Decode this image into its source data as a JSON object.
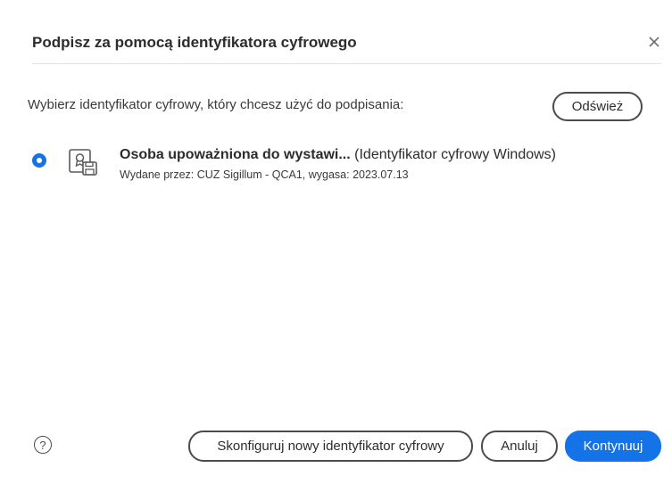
{
  "dialog": {
    "title": "Podpisz za pomocą identyfikatora cyfrowego",
    "close_icon": "close-icon",
    "prompt": "Wybierz identyfikator cyfrowy, który chcesz użyć do podpisania:",
    "refresh_label": "Odśwież"
  },
  "identities": [
    {
      "selected": true,
      "icon": "certificate-icon",
      "name": "Osoba upoważniona do wystawi...",
      "type": "(Identyfikator cyfrowy Windows)",
      "detail": "Wydane przez: CUZ Sigillum - QCA1, wygasa: 2023.07.13"
    }
  ],
  "footer": {
    "help_icon": "help-icon",
    "help_glyph": "?",
    "configure_label": "Skonfiguruj nowy identyfikator cyfrowy",
    "cancel_label": "Anuluj",
    "continue_label": "Kontynuuj"
  },
  "colors": {
    "accent": "#1473e6",
    "text": "#2c2c2c",
    "divider": "#e1e1e1"
  }
}
